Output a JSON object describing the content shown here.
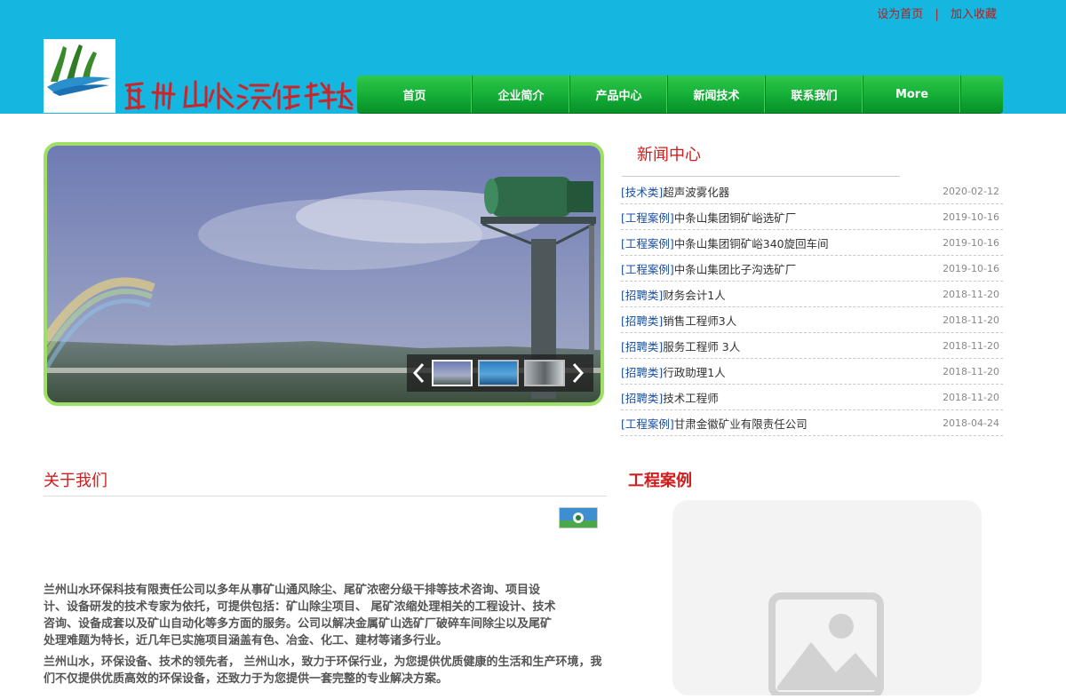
{
  "header": {
    "set_home": "设为首页",
    "separator": "|",
    "add_favorite": "加入收藏",
    "logo_caption": "山水环保",
    "brand_text": "蘭州山水環保科技"
  },
  "nav": {
    "items": [
      {
        "label": "首页"
      },
      {
        "label": "企业简介"
      },
      {
        "label": "产品中心"
      },
      {
        "label": "新闻技术"
      },
      {
        "label": "联系我们"
      },
      {
        "label": "More"
      }
    ]
  },
  "news": {
    "title": "新闻中心",
    "items": [
      {
        "category": "[技术类]",
        "title": "超声波雾化器",
        "date": "2020-02-12"
      },
      {
        "category": "[工程案例]",
        "title": "中条山集团铜矿峪选矿厂",
        "date": "2019-10-16"
      },
      {
        "category": "[工程案例]",
        "title": "中条山集团铜矿峪340旋回车间",
        "date": "2019-10-16"
      },
      {
        "category": "[工程案例]",
        "title": "中条山集团比子沟选矿厂",
        "date": "2019-10-16"
      },
      {
        "category": "[招聘类]",
        "title": "财务会计1人",
        "date": "2018-11-20"
      },
      {
        "category": "[招聘类]",
        "title": "销售工程师3人",
        "date": "2018-11-20"
      },
      {
        "category": "[招聘类]",
        "title": "服务工程师 3人",
        "date": "2018-11-20"
      },
      {
        "category": "[招聘类]",
        "title": "行政助理1人",
        "date": "2018-11-20"
      },
      {
        "category": "[招聘类]",
        "title": "技术工程师",
        "date": "2018-11-20"
      },
      {
        "category": "[工程案例]",
        "title": "甘肃金徽矿业有限责任公司",
        "date": "2018-04-24"
      }
    ]
  },
  "about": {
    "title": "关于我们",
    "para1": "兰州山水环保科技有限责任公司以多年从事矿山通风除尘、尾矿浓密分级干排等技术咨询、项目设计、设备研发的技术专家为依托，可提供包括：矿山除尘项目、 尾矿浓缩处理相关的工程设计、技术咨询、设备成套以及矿山自动化等多方面的服务。公司以解决金属矿山选矿厂破碎车间除尘以及尾矿处理难题为特长，近几年已实施项目涵盖有色、冶金、化工、建材等诸多行业。",
    "para2": "兰州山水，环保设备、技术的领先者， 兰州山水，致力于环保行业，为您提供优质健康的生活和生产环境，我们不仅提供优质高效的环保设备，还致力于为您提供一套完整的专业解决方案。"
  },
  "cases": {
    "title": "工程案例"
  },
  "colors": {
    "header_bg": "#15b7e0",
    "nav_green": "#14ad37",
    "title_red": "#d01c1c",
    "category_blue": "#1a4fa3",
    "slider_border": "#9ee066"
  }
}
